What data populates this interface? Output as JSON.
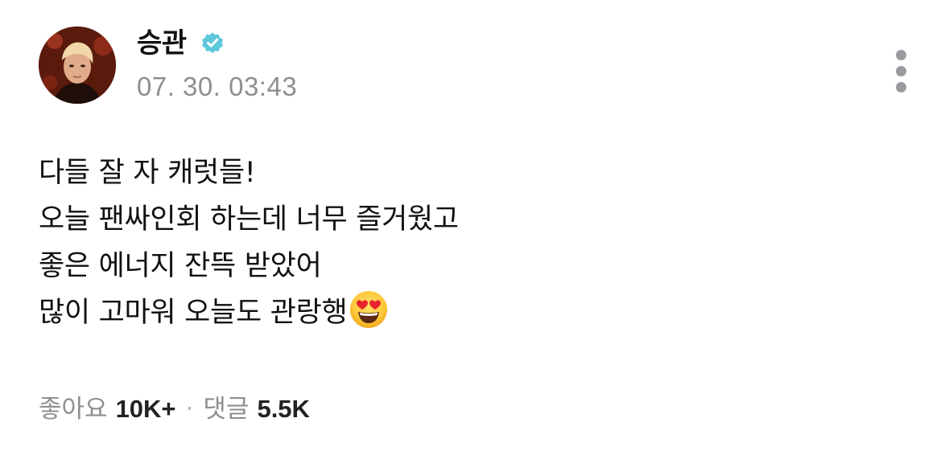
{
  "post": {
    "author": {
      "name": "승관",
      "verified": true,
      "verified_color": "#5ec8dc",
      "avatar_icon": "profile-photo"
    },
    "timestamp": "07. 30. 03:43",
    "more_icon": "more-vertical-icon",
    "content_lines": [
      "다들 잘 자 캐럿들!",
      "오늘 팬싸인회 하는데 너무 즐거웠고",
      "좋은 에너지 잔뜩 받았어",
      "많이 고마워 오늘도 관랑행"
    ],
    "content_emoji": "heart-eyes-emoji",
    "stats": {
      "likes_label": "좋아요",
      "likes_count": "10K+",
      "separator": "·",
      "comments_label": "댓글",
      "comments_count": "5.5K"
    }
  }
}
